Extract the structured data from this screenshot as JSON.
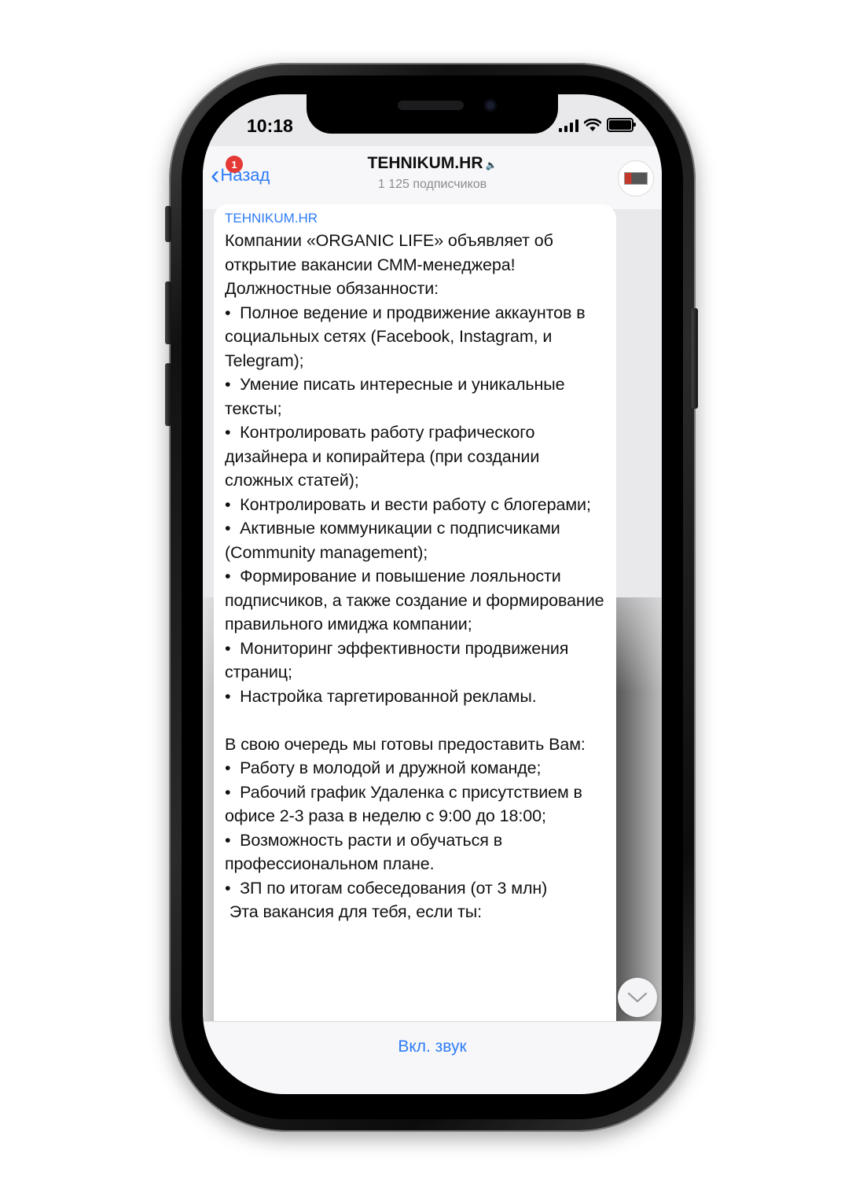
{
  "status_bar": {
    "time": "10:18"
  },
  "header": {
    "back_label": "Назад",
    "unread_badge": "1",
    "channel_name": "TEHNIKUM.HR",
    "subscribers": "1 125 подписчиков",
    "mute_icon": "muted-speaker-icon",
    "avatar_icon": "channel-avatar-icon"
  },
  "message": {
    "author": "TEHNIKUM.HR",
    "text": "Компании «ORGANIC LIFE» объявляет об открытие вакансии СММ-менеджера!\nДолжностные обязанности:\n•  Полное ведение и продвижение аккаунтов в социальных сетях (Facebook, Instagram, и Telegram);\n•  Умение писать интересные и уникальные тексты;\n•  Контролировать работу графического дизайнера и копирайтера (при создании сложных статей);\n•  Контролировать и вести работу с блогерами;\n•  Активные коммуникации с подписчиками (Community management);\n•  Формирование и повышение лояльности подписчиков, а также создание и формирование правильного имиджа компании;\n•  Мониторинг эффективности продвижения страниц;\n•  Настройка таргетированной рекламы.\n\nВ свою очередь мы готовы предоставить Вам:\n•  Работу в молодой и дружной команде;\n•  Рабочий график Удаленка с присутствием в офисе 2-3 раза в неделю с 9:00 до 18:00;\n•  Возможность расти и обучаться в профессиональном плане.\n•  ЗП по итогам собеседования (от 3 млн)\n Эта вакансия для тебя, если ты:"
  },
  "bottom_bar": {
    "mute_toggle_label": "Вкл. звук"
  },
  "colors": {
    "accent": "#2d7cf6",
    "badge": "#e53935"
  }
}
